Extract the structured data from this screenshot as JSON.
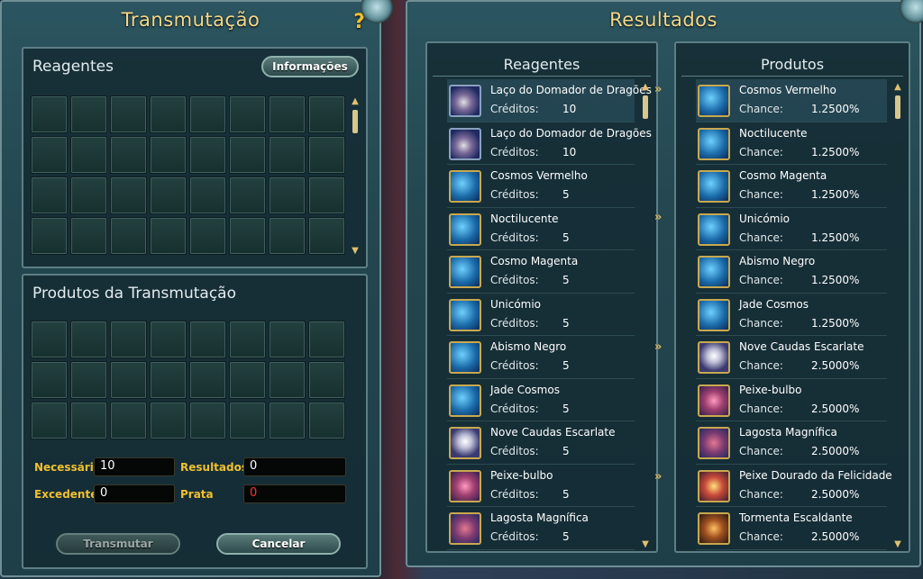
{
  "left": {
    "title": "Transmutação",
    "reagents_title": "Reagentes",
    "info_button": "Informações",
    "products_title": "Produtos da Transmutação",
    "fields": {
      "necessario_label": "Necessário",
      "necessario_value": "10",
      "resultados_label": "Resultados",
      "resultados_value": "0",
      "excedente_label": "Excedente",
      "excedente_value": "0",
      "prata_label": "Prata",
      "prata_value": "0"
    },
    "transmute_button": "Transmutar",
    "cancel_button": "Cancelar"
  },
  "right": {
    "title": "Resultados",
    "reagents_header": "Reagentes",
    "products_header": "Produtos",
    "credits_label": "Créditos:",
    "chance_label": "Chance:",
    "chevron": "»",
    "reagents": [
      {
        "name": "Laço do Domador de Dragões",
        "credits": "10",
        "icon": "lasso"
      },
      {
        "name": "Laço do Domador de Dragões",
        "credits": "10",
        "icon": "lasso"
      },
      {
        "name": "Cosmos Vermelho",
        "credits": "5",
        "icon": "blue"
      },
      {
        "name": "Noctilucente",
        "credits": "5",
        "icon": "blue"
      },
      {
        "name": "Cosmo Magenta",
        "credits": "5",
        "icon": "blue"
      },
      {
        "name": "Unicómio",
        "credits": "5",
        "icon": "blue"
      },
      {
        "name": "Abismo Negro",
        "credits": "5",
        "icon": "blue"
      },
      {
        "name": "Jade Cosmos",
        "credits": "5",
        "icon": "blue"
      },
      {
        "name": "Nove Caudas Escarlate",
        "credits": "5",
        "icon": "fox"
      },
      {
        "name": "Peixe-bulbo",
        "credits": "5",
        "icon": "fish"
      },
      {
        "name": "Lagosta Magnífica",
        "credits": "5",
        "icon": "lob"
      }
    ],
    "products": [
      {
        "name": "Cosmos Vermelho",
        "chance": "1.2500%",
        "icon": "blue"
      },
      {
        "name": "Noctilucente",
        "chance": "1.2500%",
        "icon": "blue"
      },
      {
        "name": "Cosmo Magenta",
        "chance": "1.2500%",
        "icon": "blue"
      },
      {
        "name": "Unicómio",
        "chance": "1.2500%",
        "icon": "blue"
      },
      {
        "name": "Abismo Negro",
        "chance": "1.2500%",
        "icon": "blue"
      },
      {
        "name": "Jade Cosmos",
        "chance": "1.2500%",
        "icon": "blue"
      },
      {
        "name": "Nove Caudas Escarlate",
        "chance": "2.5000%",
        "icon": "fox"
      },
      {
        "name": "Peixe-bulbo",
        "chance": "2.5000%",
        "icon": "fish"
      },
      {
        "name": "Lagosta Magnífica",
        "chance": "2.5000%",
        "icon": "lob"
      },
      {
        "name": "Peixe Dourado da Felicidade",
        "chance": "2.5000%",
        "icon": "gold"
      },
      {
        "name": "Tormenta Escaldante",
        "chance": "2.5000%",
        "icon": "tiger"
      }
    ]
  }
}
